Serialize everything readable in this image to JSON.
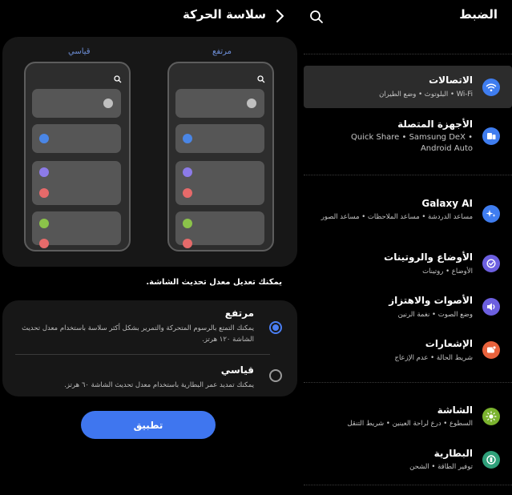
{
  "motion": {
    "title": "سلاسة الحركة",
    "preview": {
      "high_label": "مرتفع",
      "standard_label": "قياسي"
    },
    "note": "يمكنك تعديل معدل تحديث الشاشة.",
    "options": [
      {
        "title": "مرتفع",
        "desc": "يمكنك التمتع بالرسوم المتحركة والتمرير بشكل أكثر سلاسة باستخدام معدل تحديث الشاشة ١٢٠ هرتز.",
        "selected": true
      },
      {
        "title": "قياسي",
        "desc": "يمكنك تمديد عمر البطارية باستخدام معدل تحديث الشاشة ٦٠ هرتز.",
        "selected": false
      }
    ],
    "apply_label": "تطبيق"
  },
  "settings": {
    "title": "الضبط",
    "items": [
      {
        "title": "الاتصالات",
        "subtitle": "Wi-Fi • البلوتوث • وضع الطيران",
        "icon": "wifi-icon",
        "color": "#3f7df0",
        "selected": true
      },
      {
        "title": "الأجهزة المتصلة",
        "subtitle": "Quick Share • Samsung DeX • Android Auto",
        "icon": "connected-devices-icon",
        "color": "#3f7df0"
      },
      {
        "title": "Galaxy AI",
        "subtitle": "مساعد الدردشة • مساعد الملاحظات • مساعد الصور",
        "icon": "galaxy-ai-icon",
        "color": "#3f7df0"
      },
      {
        "title": "الأوضاع والروتينات",
        "subtitle": "الأوضاع • روتينات",
        "icon": "modes-routines-icon",
        "color": "#6c5fe0"
      },
      {
        "title": "الأصوات والاهتزاز",
        "subtitle": "وضع الصوت • نغمة الرنين",
        "icon": "sound-icon",
        "color": "#6c5fe0"
      },
      {
        "title": "الإشعارات",
        "subtitle": "شريط الحالة • عدم الإزعاج",
        "icon": "notifications-icon",
        "color": "#e8623c"
      },
      {
        "title": "الشاشة",
        "subtitle": "السطوع • درع لراحة العينين • شريط التنقل",
        "icon": "display-icon",
        "color": "#7bb32e"
      },
      {
        "title": "البطارية",
        "subtitle": "توفير الطاقة • الشحن",
        "icon": "battery-icon",
        "color": "#2fa07a"
      }
    ]
  },
  "colors": {
    "accent": "#3f76ef",
    "dot_gray": "#c0c0c0",
    "dot_blue": "#4a86e6",
    "dot_purple": "#8c7be8",
    "dot_red": "#e66a6a",
    "dot_green": "#8bc34a"
  }
}
